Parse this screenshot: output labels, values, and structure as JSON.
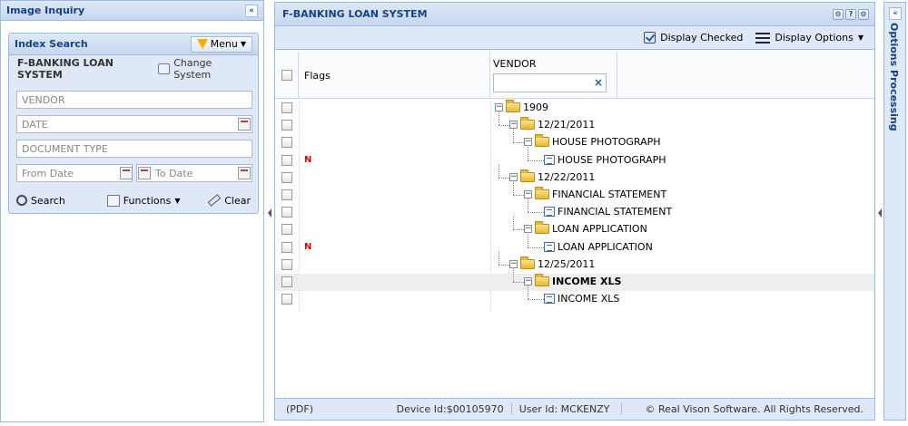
{
  "left_panel": {
    "title": "Image Inquiry",
    "collapse_glyph": "«",
    "index_search": {
      "title": "Index Search",
      "menu_label": "Menu",
      "system_name": "F-BANKING LOAN SYSTEM",
      "change_system_label": "Change System",
      "vendor_placeholder": "VENDOR",
      "date_placeholder": "DATE",
      "doc_type_placeholder": "DOCUMENT TYPE",
      "from_date_placeholder": "From Date",
      "to_date_placeholder": "To Date",
      "search_label": "Search",
      "functions_label": "Functions",
      "clear_label": "Clear"
    }
  },
  "main_panel": {
    "title": "F-BANKING LOAN SYSTEM",
    "tools": [
      "⚙",
      "?",
      "⚙"
    ],
    "toolbar": {
      "display_checked_label": "Display Checked",
      "display_options_label": "Display Options"
    },
    "grid": {
      "col_flags": "Flags",
      "col_vendor": "VENDOR",
      "filter_clear_glyph": "×",
      "rows": [
        {
          "flag": "",
          "label": "1909",
          "type": "folder",
          "level": 0
        },
        {
          "flag": "",
          "label": "12/21/2011",
          "type": "folder",
          "level": 1
        },
        {
          "flag": "",
          "label": "HOUSE PHOTOGRAPH",
          "type": "folder",
          "level": 2
        },
        {
          "flag": "N",
          "label": "HOUSE PHOTOGRAPH",
          "type": "doc",
          "level": 3
        },
        {
          "flag": "",
          "label": "12/22/2011",
          "type": "folder",
          "level": 1
        },
        {
          "flag": "",
          "label": "FINANCIAL STATEMENT",
          "type": "folder",
          "level": 2
        },
        {
          "flag": "",
          "label": "FINANCIAL STATEMENT",
          "type": "doc",
          "level": 3
        },
        {
          "flag": "",
          "label": "LOAN APPLICATION",
          "type": "folder",
          "level": 2
        },
        {
          "flag": "N",
          "label": "LOAN APPLICATION",
          "type": "doc",
          "level": 3
        },
        {
          "flag": "",
          "label": "12/25/2011",
          "type": "folder",
          "level": 1
        },
        {
          "flag": "",
          "label": "INCOME XLS",
          "type": "folder",
          "level": 2,
          "selected": true
        },
        {
          "flag": "",
          "label": "INCOME XLS",
          "type": "doc",
          "level": 3
        }
      ]
    },
    "status": {
      "format": "(PDF)",
      "device_id": "Device Id:$00105970",
      "user_id": "User Id: MCKENZY",
      "copyright": "© Real Vison Software. All Rights Reserved."
    }
  },
  "right_panel": {
    "title": "Options Processing",
    "expand_glyph": "«"
  }
}
